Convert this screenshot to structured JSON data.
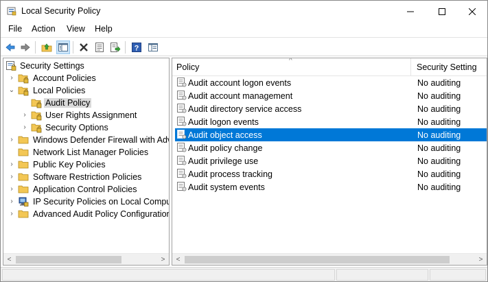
{
  "window": {
    "title": "Local Security Policy",
    "controls": {
      "minimize": "—",
      "maximize": "☐",
      "close": "✕"
    }
  },
  "menu": [
    "File",
    "Action",
    "View",
    "Help"
  ],
  "toolbar": {
    "icons": [
      "back-icon",
      "forward-icon",
      "up-folder-icon",
      "show-hide-tree-icon",
      "delete-icon",
      "properties-icon",
      "export-list-icon",
      "help-icon",
      "console-view-icon"
    ],
    "active": "show-hide-tree-icon"
  },
  "tree": {
    "items": [
      {
        "label": "Security Settings",
        "expander": "",
        "icon": "security-settings-icon"
      },
      {
        "label": "Account Policies",
        "expander": "›",
        "icon": "folder-lock-icon"
      },
      {
        "label": "Local Policies",
        "expander": "⌄",
        "icon": "folder-lock-icon"
      },
      {
        "label": "Audit Policy",
        "expander": "",
        "icon": "folder-lock-icon",
        "selected": true
      },
      {
        "label": "User Rights Assignment",
        "expander": "›",
        "icon": "folder-lock-icon"
      },
      {
        "label": "Security Options",
        "expander": "›",
        "icon": "folder-lock-icon"
      },
      {
        "label": "Windows Defender Firewall with Adva",
        "expander": "›",
        "icon": "folder-icon"
      },
      {
        "label": "Network List Manager Policies",
        "expander": "",
        "icon": "folder-icon"
      },
      {
        "label": "Public Key Policies",
        "expander": "›",
        "icon": "folder-icon"
      },
      {
        "label": "Software Restriction Policies",
        "expander": "›",
        "icon": "folder-icon"
      },
      {
        "label": "Application Control Policies",
        "expander": "›",
        "icon": "folder-icon"
      },
      {
        "label": "IP Security Policies on Local Compute",
        "expander": "›",
        "icon": "ip-security-icon"
      },
      {
        "label": "Advanced Audit Policy Configuration",
        "expander": "›",
        "icon": "folder-icon"
      }
    ]
  },
  "list": {
    "columns": {
      "policy": "Policy",
      "setting": "Security Setting"
    },
    "rows": [
      {
        "policy": "Audit account logon events",
        "setting": "No auditing"
      },
      {
        "policy": "Audit account management",
        "setting": "No auditing"
      },
      {
        "policy": "Audit directory service access",
        "setting": "No auditing"
      },
      {
        "policy": "Audit logon events",
        "setting": "No auditing"
      },
      {
        "policy": "Audit object access",
        "setting": "No auditing",
        "selected": true
      },
      {
        "policy": "Audit policy change",
        "setting": "No auditing"
      },
      {
        "policy": "Audit privilege use",
        "setting": "No auditing"
      },
      {
        "policy": "Audit process tracking",
        "setting": "No auditing"
      },
      {
        "policy": "Audit system events",
        "setting": "No auditing"
      }
    ]
  },
  "colors": {
    "selection": "#0078d7",
    "tree_selection": "#d9d9d9",
    "folder": "#f3c755",
    "lock": "#c9a227"
  }
}
